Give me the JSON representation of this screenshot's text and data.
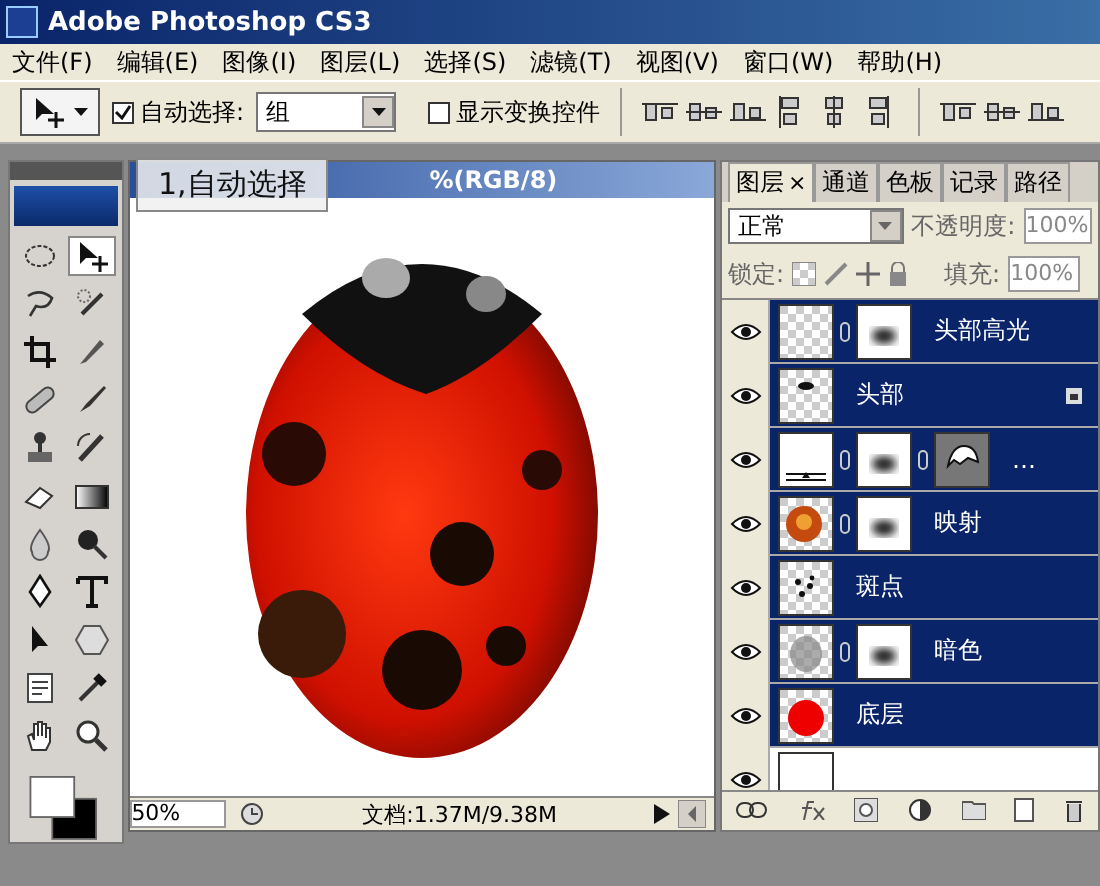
{
  "window": {
    "title": "Adobe Photoshop CS3"
  },
  "menu": [
    "文件(F)",
    "编辑(E)",
    "图像(I)",
    "图层(L)",
    "选择(S)",
    "滤镜(T)",
    "视图(V)",
    "窗口(W)",
    "帮助(H)"
  ],
  "options_bar": {
    "auto_select": {
      "label": "自动选择:",
      "checked": true
    },
    "auto_select_target": "组",
    "show_transform": {
      "label": "显示变换控件",
      "checked": false
    }
  },
  "tooltip": "1,自动选择",
  "tools": [
    {
      "kind": "marquee",
      "selected": false
    },
    {
      "kind": "move",
      "selected": true
    },
    {
      "kind": "lasso",
      "selected": false
    },
    {
      "kind": "wand",
      "selected": false
    },
    {
      "kind": "crop",
      "selected": false
    },
    {
      "kind": "knife",
      "selected": false
    },
    {
      "kind": "bandage",
      "selected": false
    },
    {
      "kind": "brush",
      "selected": false
    },
    {
      "kind": "stamp",
      "selected": false
    },
    {
      "kind": "history",
      "selected": false
    },
    {
      "kind": "eraser",
      "selected": false
    },
    {
      "kind": "gradient",
      "selected": false
    },
    {
      "kind": "drop",
      "selected": false
    },
    {
      "kind": "burn",
      "selected": false
    },
    {
      "kind": "pen",
      "selected": false
    },
    {
      "kind": "type",
      "selected": false
    },
    {
      "kind": "arrow",
      "selected": false
    },
    {
      "kind": "hexagon",
      "selected": false
    },
    {
      "kind": "note",
      "selected": false
    },
    {
      "kind": "eyedropper",
      "selected": false
    },
    {
      "kind": "hand",
      "selected": false
    },
    {
      "kind": "zoom",
      "selected": false
    }
  ],
  "document": {
    "title": "%(RGB/8)",
    "zoom": "50%",
    "status": "文档:1.37M/9.38M"
  },
  "layers_panel": {
    "tabs": [
      {
        "label": "图层",
        "selected": true,
        "close": "×"
      },
      {
        "label": "通道",
        "selected": false
      },
      {
        "label": "色板",
        "selected": false
      },
      {
        "label": "记录",
        "selected": false
      },
      {
        "label": "路径",
        "selected": false
      }
    ],
    "blend_mode": "正常",
    "opacity_label": "不透明度:",
    "opacity": "100%",
    "lock_label": "锁定:",
    "fill_label": "填充:",
    "fill": "100%",
    "layers": [
      {
        "name": "头部高光",
        "kind": "highlight",
        "mask": true,
        "vector_mask": false,
        "locked": false,
        "visible": true,
        "selected": true
      },
      {
        "name": "头部",
        "kind": "head",
        "mask": false,
        "vector_mask": false,
        "locked": true,
        "visible": true,
        "selected": true
      },
      {
        "name": "…",
        "kind": "adjustment",
        "mask": true,
        "vector_mask": true,
        "locked": false,
        "visible": true,
        "selected": true
      },
      {
        "name": "映射",
        "kind": "orange",
        "mask": true,
        "vector_mask": false,
        "locked": false,
        "visible": true,
        "selected": true
      },
      {
        "name": "斑点",
        "kind": "spots",
        "mask": false,
        "vector_mask": false,
        "locked": false,
        "visible": true,
        "selected": true
      },
      {
        "name": "暗色",
        "kind": "gray",
        "mask": true,
        "vector_mask": false,
        "locked": false,
        "visible": true,
        "selected": true
      },
      {
        "name": "底层",
        "kind": "red",
        "mask": false,
        "vector_mask": false,
        "locked": false,
        "visible": true,
        "selected": true
      },
      {
        "kind": "white",
        "mask": false,
        "vector_mask": false,
        "locked": false,
        "visible": true,
        "selected": false
      }
    ]
  }
}
